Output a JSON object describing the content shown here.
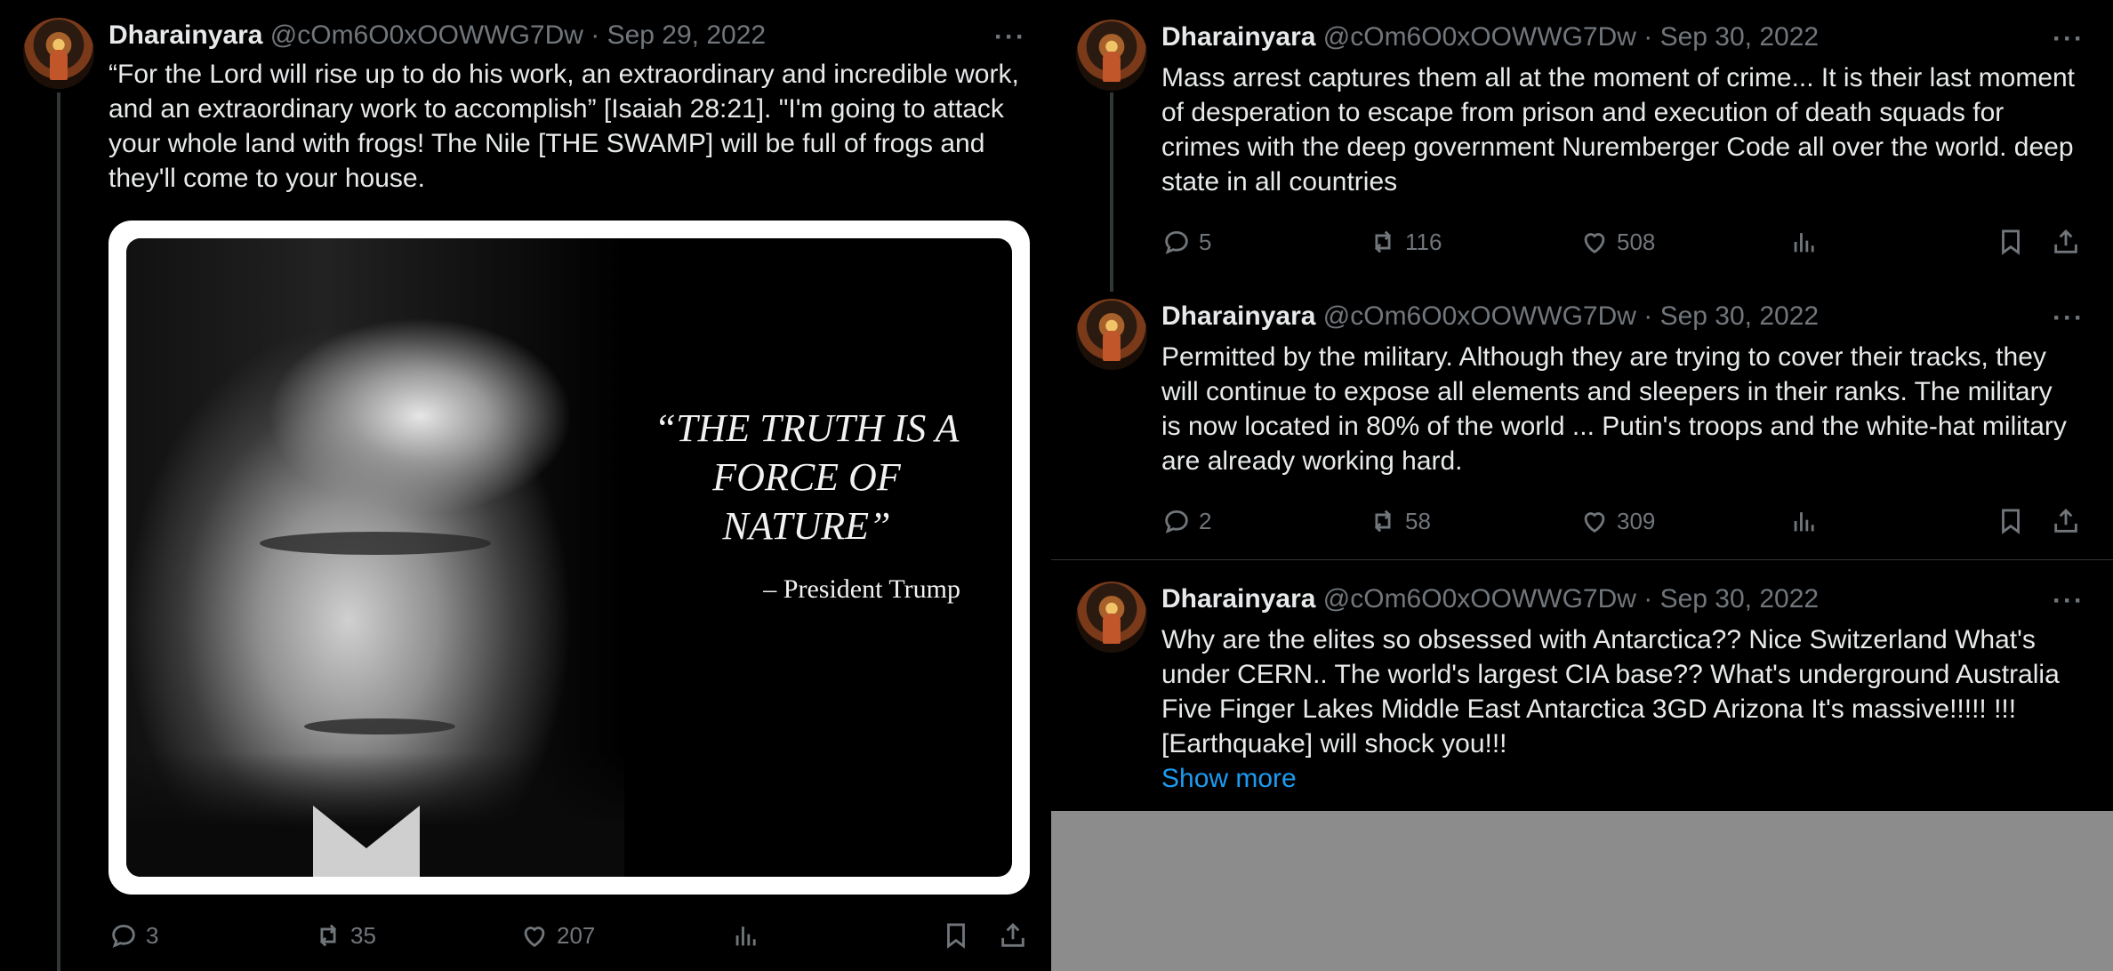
{
  "left": {
    "tweet": {
      "name": "Dharainyara",
      "meta": "@cOm6O0xOOWWG7Dw · Sep 29, 2022",
      "more": "···",
      "text": "“For the Lord will rise up to do his work, an extraordinary and incredible work, and an extraordinary work to accomplish” [Isaiah 28:21]. \"I'm going to attack your whole land with frogs! The Nile [THE SWAMP] will be full of frogs and they'll come to your house.",
      "image": {
        "quote": "“THE TRUTH IS A FORCE OF NATURE”",
        "attribution": "– President Trump"
      },
      "replies": "3",
      "retweets": "35",
      "likes": "207"
    }
  },
  "right": {
    "tweets": [
      {
        "name": "Dharainyara",
        "meta": "@cOm6O0xOOWWG7Dw · Sep 30, 2022",
        "more": "···",
        "text": "Mass arrest captures them all at the moment of crime... It is their last moment of desperation to escape from prison and execution of death squads for crimes with the deep government Nuremberger Code all over the world. deep state in all countries",
        "replies": "5",
        "retweets": "116",
        "likes": "508"
      },
      {
        "name": "Dharainyara",
        "meta": "@cOm6O0xOOWWG7Dw · Sep 30, 2022",
        "more": "···",
        "text": "Permitted by the military. Although they are trying to cover their tracks, they will continue to expose all elements and sleepers in their ranks. The military is now located in 80% of the world ... Putin's troops and the white-hat military are already working hard.",
        "replies": "2",
        "retweets": "58",
        "likes": "309"
      },
      {
        "name": "Dharainyara",
        "meta": "@cOm6O0xOOWWG7Dw · Sep 30, 2022",
        "more": "···",
        "text": "Why are the elites so obsessed with Antarctica?? Nice Switzerland What's under CERN.. The world's largest CIA base?? What's underground Australia Five Finger Lakes Middle East Antarctica 3GD Arizona It's massive!!!!! !!! [Earthquake] will shock you!!!",
        "show_more": "Show more"
      }
    ]
  },
  "icons": [
    "reply-icon",
    "retweet-icon",
    "like-icon",
    "views-icon",
    "bookmark-icon",
    "share-icon",
    "more-icon"
  ],
  "colors": {
    "background": "#000000",
    "text": "#e7e9ea",
    "muted": "#71767b",
    "link": "#1d9bf0",
    "divider": "#2f3336"
  }
}
